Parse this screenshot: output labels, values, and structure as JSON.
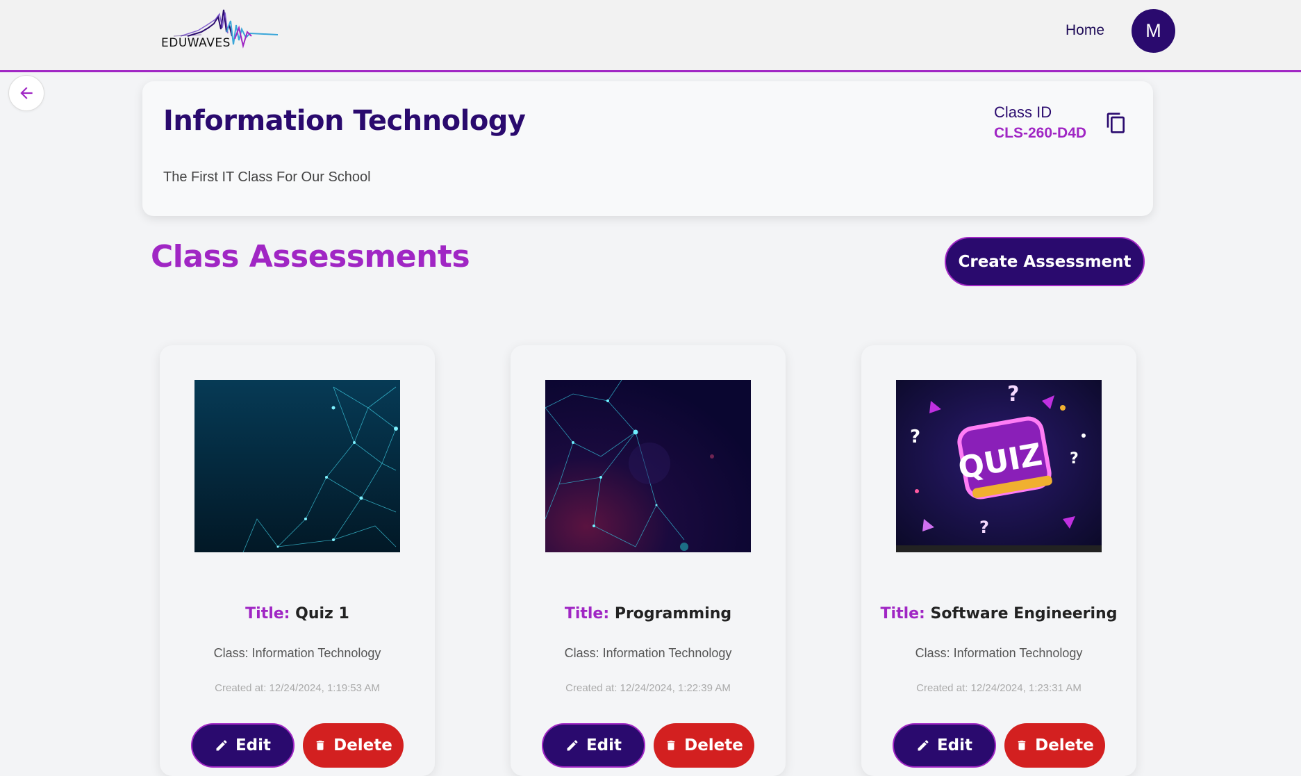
{
  "header": {
    "logo_text": "EDUWAVES",
    "nav_home": "Home",
    "avatar_initial": "M"
  },
  "class_info": {
    "title": "Information Technology",
    "description": "The First IT Class For Our School",
    "id_label": "Class ID",
    "id_value": "CLS-260-D4D"
  },
  "assessments_section": {
    "title": "Class Assessments",
    "create_button": "Create Assessment"
  },
  "assessments": [
    {
      "title_label": "Title:",
      "title": "Quiz 1",
      "class": "Class: Information Technology",
      "created": "Created at: 12/24/2024, 1:19:53 AM",
      "edit": "Edit",
      "delete": "Delete"
    },
    {
      "title_label": "Title:",
      "title": "Programming",
      "class": "Class: Information Technology",
      "created": "Created at: 12/24/2024, 1:22:39 AM",
      "edit": "Edit",
      "delete": "Delete"
    },
    {
      "title_label": "Title:",
      "title": "Software Engineering",
      "class": "Class: Information Technology",
      "created": "Created at: 12/24/2024, 1:23:31 AM",
      "edit": "Edit",
      "delete": "Delete"
    }
  ],
  "colors": {
    "primary": "#2a0a6e",
    "accent": "#a026c4",
    "danger": "#d32020"
  },
  "icons": {
    "back": "arrow-left-icon",
    "copy": "copy-icon",
    "edit": "pencil-icon",
    "delete": "trash-icon"
  }
}
